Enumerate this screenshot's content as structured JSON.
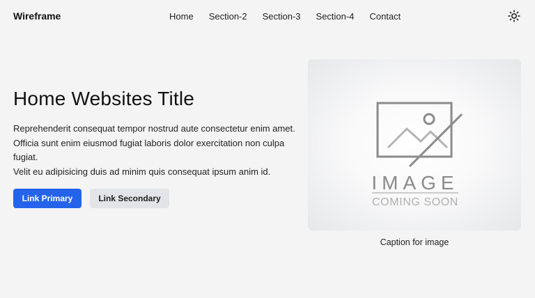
{
  "nav": {
    "brand": "Wireframe",
    "links": [
      "Home",
      "Section-2",
      "Section-3",
      "Section-4",
      "Contact"
    ],
    "theme_icon": "sun-icon"
  },
  "hero": {
    "title": "Home Websites Title",
    "paragraphs": [
      "Reprehenderit consequat tempor nostrud aute consectetur enim amet.",
      "Officia sunt enim eiusmod fugiat laboris dolor exercitation non culpa fugiat.",
      "Velit eu adipisicing duis ad minim quis consequat ipsum anim id."
    ],
    "primary_button": "Link Primary",
    "secondary_button": "Link Secondary"
  },
  "image": {
    "placeholder_title": "IMAGE",
    "placeholder_subtitle": "COMING SOON",
    "caption": "Caption for image",
    "icon": "image-placeholder-icon"
  },
  "colors": {
    "primary": "#2563eb",
    "secondary": "#e3e4e7",
    "background": "#f4f4f5"
  }
}
